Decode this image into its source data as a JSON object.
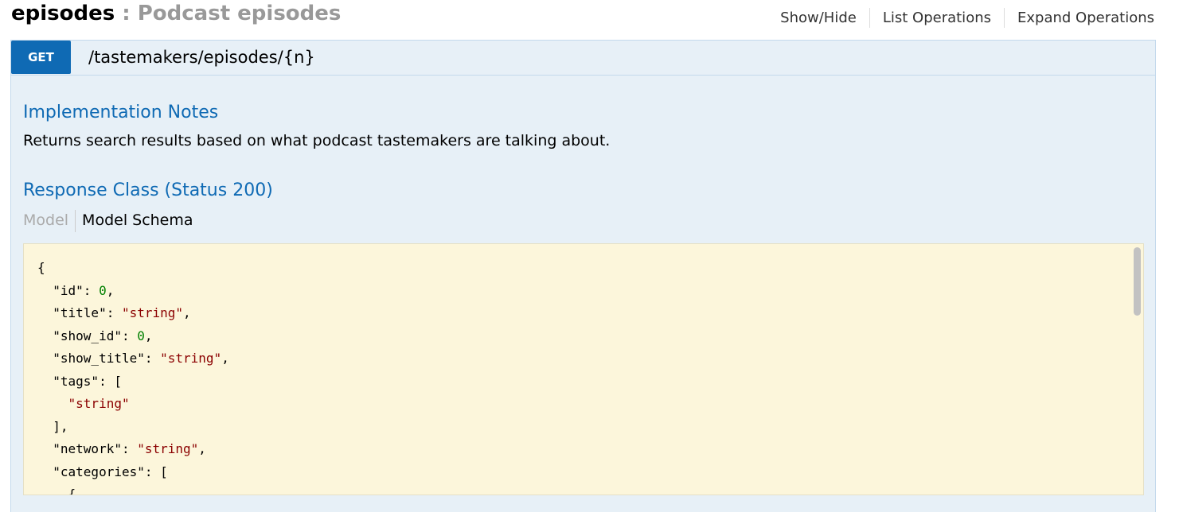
{
  "resource": {
    "name": "episodes",
    "separator": " : ",
    "description": "Podcast episodes",
    "operations": [
      "Show/Hide",
      "List Operations",
      "Expand Operations"
    ]
  },
  "operation": {
    "method": "GET",
    "path": "/tastemakers/episodes/{n}",
    "impl_heading": "Implementation Notes",
    "impl_text": "Returns search results based on what podcast tastemakers are talking about.",
    "response_heading": "Response Class (Status 200)",
    "tabs": [
      "Model",
      "Model Schema"
    ],
    "active_tab": "Model Schema"
  },
  "schema_lines": [
    [
      {
        "t": "{",
        "c": "k"
      }
    ],
    [
      {
        "t": "  \"id\": ",
        "c": "k"
      },
      {
        "t": "0",
        "c": "n"
      },
      {
        "t": ",",
        "c": "k"
      }
    ],
    [
      {
        "t": "  \"title\": ",
        "c": "k"
      },
      {
        "t": "\"string\"",
        "c": "s"
      },
      {
        "t": ",",
        "c": "k"
      }
    ],
    [
      {
        "t": "  \"show_id\": ",
        "c": "k"
      },
      {
        "t": "0",
        "c": "n"
      },
      {
        "t": ",",
        "c": "k"
      }
    ],
    [
      {
        "t": "  \"show_title\": ",
        "c": "k"
      },
      {
        "t": "\"string\"",
        "c": "s"
      },
      {
        "t": ",",
        "c": "k"
      }
    ],
    [
      {
        "t": "  \"tags\": [",
        "c": "k"
      }
    ],
    [
      {
        "t": "    ",
        "c": "k"
      },
      {
        "t": "\"string\"",
        "c": "s"
      }
    ],
    [
      {
        "t": "  ],",
        "c": "k"
      }
    ],
    [
      {
        "t": "  \"network\": ",
        "c": "k"
      },
      {
        "t": "\"string\"",
        "c": "s"
      },
      {
        "t": ",",
        "c": "k"
      }
    ],
    [
      {
        "t": "  \"categories\": [",
        "c": "k"
      }
    ],
    [
      {
        "t": "    {",
        "c": "k"
      }
    ]
  ],
  "colors": {
    "accent": "#0f6ab4",
    "panel_bg": "#e7f0f7",
    "schema_bg": "#fcf6db",
    "string": "#8b0000",
    "number": "#008000"
  }
}
